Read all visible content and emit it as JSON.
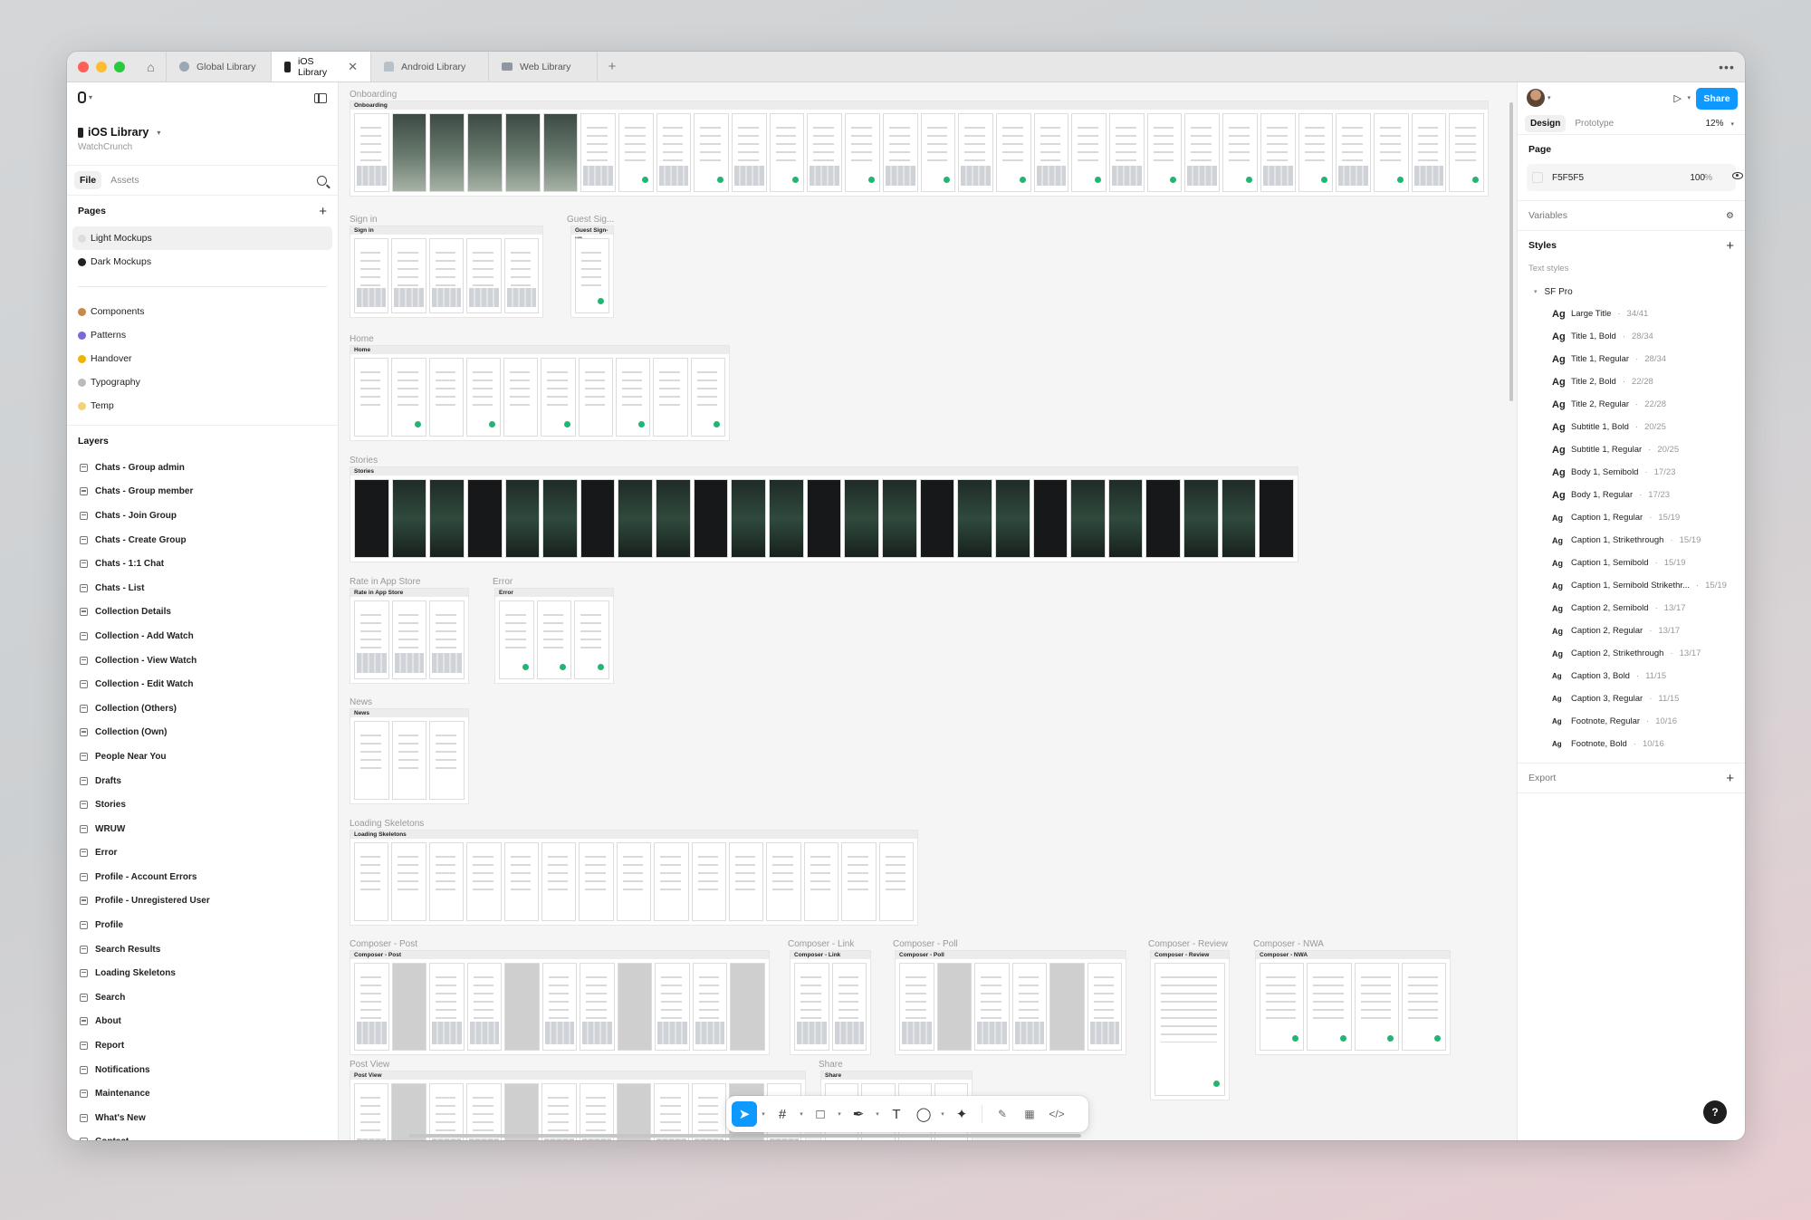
{
  "window": {
    "tabs": [
      {
        "label": "Global Library",
        "icon": "globe-icon"
      },
      {
        "label": "iOS Library",
        "icon": "phone-icon",
        "active": true
      },
      {
        "label": "Android Library",
        "icon": "android-icon"
      },
      {
        "label": "Web Library",
        "icon": "web-icon"
      }
    ],
    "close_glyph": "✕",
    "plus_glyph": "+",
    "more_glyph": "•••",
    "home_glyph": "⌂"
  },
  "left_panel": {
    "file_name": "iOS Library",
    "team": "WatchCrunch",
    "tabs": {
      "file": "File",
      "assets": "Assets"
    },
    "pages_heading": "Pages",
    "pages": [
      {
        "label": "Light Mockups",
        "color": "#dddddd",
        "active": true
      },
      {
        "label": "Dark Mockups",
        "color": "#222222"
      }
    ],
    "pages_secondary": [
      {
        "label": "Components",
        "color": "#c58a4a"
      },
      {
        "label": "Patterns",
        "color": "#7a6ad8"
      },
      {
        "label": "Handover",
        "color": "#f0b400"
      },
      {
        "label": "Typography",
        "color": "#bbbbbb"
      },
      {
        "label": "Temp",
        "color": "#f3d27a"
      }
    ],
    "layers_heading": "Layers",
    "layers": [
      "Chats - Group admin",
      "Chats - Group member",
      "Chats - Join Group",
      "Chats - Create Group",
      "Chats - 1:1 Chat",
      "Chats - List",
      "Collection Details",
      "Collection - Add Watch",
      "Collection - View Watch",
      "Collection - Edit Watch",
      "Collection (Others)",
      "Collection (Own)",
      "People Near You",
      "Drafts",
      "Stories",
      "WRUW",
      "Error",
      "Profile - Account Errors",
      "Profile - Unregistered User",
      "Profile",
      "Search Results",
      "Loading Skeletons",
      "Search",
      "About",
      "Report",
      "Notifications",
      "Maintenance",
      "What's New",
      "Contact"
    ]
  },
  "canvas": {
    "sections": [
      {
        "label": "Onboarding",
        "title": "Onboarding"
      },
      {
        "label": "Sign in",
        "title": "Sign in"
      },
      {
        "label": "Guest Sig...",
        "title": "Guest Sign-up"
      },
      {
        "label": "Home",
        "title": "Home"
      },
      {
        "label": "Stories",
        "title": "Stories"
      },
      {
        "label": "Rate in App Store",
        "title": "Rate in App Store"
      },
      {
        "label": "Error",
        "title": "Error"
      },
      {
        "label": "News",
        "title": "News"
      },
      {
        "label": "Loading Skeletons",
        "title": "Loading Skeletons"
      },
      {
        "label": "Composer - Post",
        "title": "Composer - Post"
      },
      {
        "label": "Composer - Link",
        "title": "Composer - Link"
      },
      {
        "label": "Composer - Poll",
        "title": "Composer - Poll"
      },
      {
        "label": "Composer - Review",
        "title": "Composer - Review"
      },
      {
        "label": "Composer - NWA",
        "title": "Composer - NWA"
      },
      {
        "label": "Post View",
        "title": "Post View"
      },
      {
        "label": "Share",
        "title": "Share"
      }
    ]
  },
  "toolbar": {
    "tools": [
      {
        "name": "move-tool",
        "glyph": "➤",
        "active": true
      },
      {
        "name": "frame-tool",
        "glyph": "#"
      },
      {
        "name": "shape-tool",
        "glyph": "□"
      },
      {
        "name": "pen-tool",
        "glyph": "✒"
      },
      {
        "name": "text-tool",
        "glyph": "T"
      },
      {
        "name": "comment-tool",
        "glyph": "◯"
      },
      {
        "name": "actions-tool",
        "glyph": "✦"
      }
    ],
    "mode_tools": [
      {
        "name": "draw-mode",
        "glyph": "✎"
      },
      {
        "name": "dev-mode-toggle",
        "glyph": "▦"
      },
      {
        "name": "code-mode",
        "glyph": "</>"
      }
    ]
  },
  "right_panel": {
    "tabs": {
      "design": "Design",
      "prototype": "Prototype"
    },
    "zoom": "12%",
    "share_label": "Share",
    "page_heading": "Page",
    "page_color": "F5F5F5",
    "page_opacity": "100",
    "percent": "%",
    "variables_heading": "Variables",
    "styles_heading": "Styles",
    "text_styles_label": "Text styles",
    "font_group": "SF Pro",
    "text_styles": [
      {
        "name": "Large Title",
        "metric": "34/41",
        "size": "lg"
      },
      {
        "name": "Title 1, Bold",
        "metric": "28/34",
        "size": "lg"
      },
      {
        "name": "Title 1, Regular",
        "metric": "28/34",
        "size": "lg"
      },
      {
        "name": "Title 2, Bold",
        "metric": "22/28",
        "size": "lg"
      },
      {
        "name": "Title 2, Regular",
        "metric": "22/28",
        "size": "lg"
      },
      {
        "name": "Subtitle 1, Bold",
        "metric": "20/25",
        "size": "lg"
      },
      {
        "name": "Subtitle 1, Regular",
        "metric": "20/25",
        "size": "lg"
      },
      {
        "name": "Body 1, Semibold",
        "metric": "17/23",
        "size": "lg"
      },
      {
        "name": "Body 1, Regular",
        "metric": "17/23",
        "size": "lg"
      },
      {
        "name": "Caption 1, Regular",
        "metric": "15/19",
        "size": "sm"
      },
      {
        "name": "Caption 1, Strikethrough",
        "metric": "15/19",
        "size": "sm"
      },
      {
        "name": "Caption 1, Semibold",
        "metric": "15/19",
        "size": "sm"
      },
      {
        "name": "Caption 1, Semibold Strikethr...",
        "metric": "15/19",
        "size": "sm"
      },
      {
        "name": "Caption 2, Semibold",
        "metric": "13/17",
        "size": "sm"
      },
      {
        "name": "Caption 2, Regular",
        "metric": "13/17",
        "size": "sm"
      },
      {
        "name": "Caption 2, Strikethrough",
        "metric": "13/17",
        "size": "sm"
      },
      {
        "name": "Caption 3, Bold",
        "metric": "11/15",
        "size": "xs"
      },
      {
        "name": "Caption 3, Regular",
        "metric": "11/15",
        "size": "xs"
      },
      {
        "name": "Footnote, Regular",
        "metric": "10/16",
        "size": "xs"
      },
      {
        "name": "Footnote, Bold",
        "metric": "10/16",
        "size": "xs"
      }
    ],
    "export_heading": "Export",
    "help_glyph": "?"
  },
  "colors": {
    "accent": "#0d99ff",
    "green": "#22b573",
    "canvas_bg": "#f5f5f5"
  }
}
